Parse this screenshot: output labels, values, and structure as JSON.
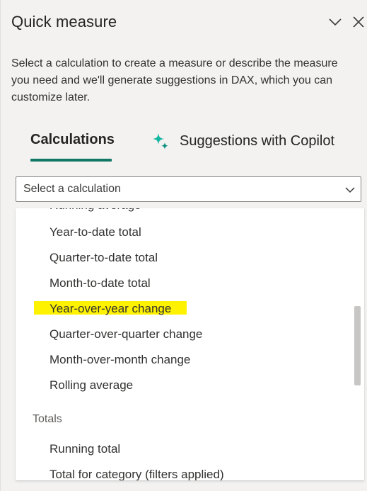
{
  "header": {
    "title": "Quick measure",
    "collapse_icon": "chevron-down-icon",
    "close_icon": "close-icon"
  },
  "description": "Select a calculation to create a measure or describe the measure you need and we'll generate suggestions in DAX, which you can customize later.",
  "tabs": [
    {
      "label": "Calculations",
      "selected": true
    },
    {
      "label": "Suggestions with Copilot",
      "icon": "sparkle-icon",
      "selected": false
    }
  ],
  "calculation_select": {
    "placeholder": "Select a calculation"
  },
  "dropdown": {
    "time_intelligence_items": [
      "Year-to-date total",
      "Quarter-to-date total",
      "Month-to-date total",
      "Year-over-year change",
      "Quarter-over-quarter change",
      "Month-over-month change",
      "Rolling average"
    ],
    "highlighted_item": "Year-over-year change",
    "totals_header": "Totals",
    "totals_items": [
      "Running total",
      "Total for category (filters applied)"
    ]
  },
  "colors": {
    "accent": "#117865",
    "copilot_sparkle": "#12b5a0",
    "highlight": "#fff200",
    "panel_bg": "#f3f2f1"
  }
}
